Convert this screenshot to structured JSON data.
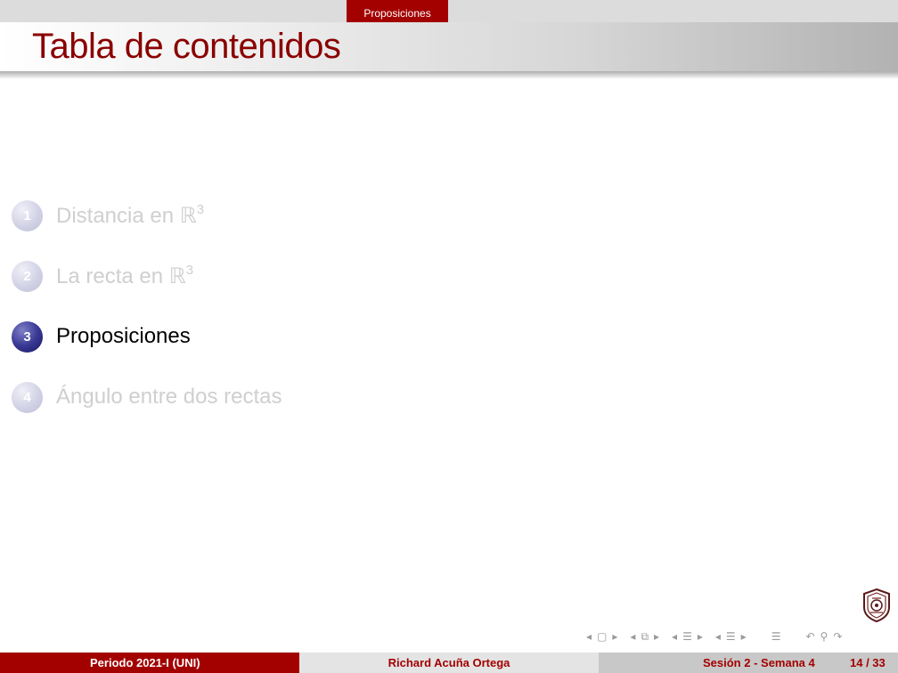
{
  "header": {
    "section_tab": "Proposiciones"
  },
  "frame": {
    "title": "Tabla de contenidos"
  },
  "toc": {
    "items": [
      {
        "number": "1",
        "label": "Distancia en ",
        "math": "ℝ",
        "sup": "3",
        "active": false
      },
      {
        "number": "2",
        "label": "La recta en ",
        "math": "ℝ",
        "sup": "3",
        "active": false
      },
      {
        "number": "3",
        "label": "Proposiciones",
        "active": true
      },
      {
        "number": "4",
        "label": "Ángulo entre dos rectas",
        "active": false
      }
    ]
  },
  "footer": {
    "period": "Periodo 2021-I  (UNI)",
    "author": "Richard Acuña Ortega",
    "session": "Sesión 2 - Semana 4",
    "page": "14 / 33"
  },
  "icons": {
    "crest": "university-crest-icon",
    "nav": [
      "prev-frame-icon",
      "frame-icon",
      "next-frame-icon",
      "prev-subsection-icon",
      "subsection-icon",
      "next-subsection-icon",
      "prev-section-icon",
      "section-icon",
      "next-section-icon",
      "prev-page-icon",
      "document-icon",
      "next-page-icon",
      "back-icon",
      "search-icon",
      "forward-icon"
    ]
  },
  "colors": {
    "accent": "#a30000",
    "title": "#8a0000",
    "ball_active": "#3a3a96",
    "inactive_text": "#cfcfcf"
  }
}
